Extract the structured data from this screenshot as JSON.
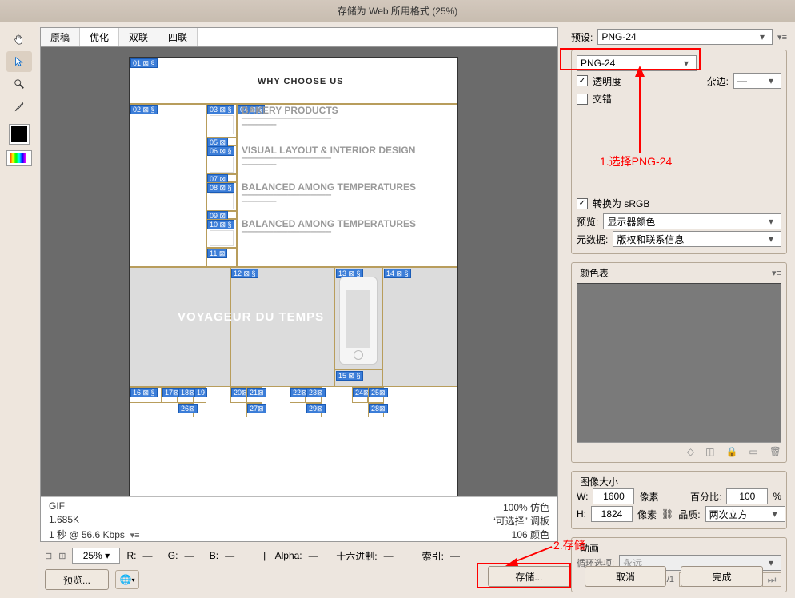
{
  "title": "存储为 Web 所用格式 (25%)",
  "tabs": {
    "t0": "原稿",
    "t1": "优化",
    "t2": "双联",
    "t3": "四联"
  },
  "tools": {
    "hand": "hand",
    "arrow": "arrow",
    "zoom": "zoom",
    "eyedrop": "eyedrop"
  },
  "preview": {
    "heading": "WHY CHOOSE US",
    "ghost": "VOYAGEUR DU TEMPS",
    "sub1": "BAKERY PRODUCTS",
    "sub2": "VISUAL LAYOUT & INTERIOR DESIGN",
    "sub3": "BALANCED AMONG TEMPERATURES",
    "sub4": "BALANCED AMONG TEMPERATURES"
  },
  "info": {
    "fmt": "GIF",
    "size": "1.685K",
    "time": "1 秒 @ 56.6 Kbps",
    "dither": "100% 仿色",
    "palette": "“可选择” 调板",
    "colors": "106 颜色"
  },
  "status": {
    "zoom": "25%",
    "r": "R:",
    "g": "G:",
    "b": "B:",
    "alpha": "Alpha:",
    "hex": "十六进制:",
    "index": "索引:",
    "dash": "—"
  },
  "right": {
    "presetLbl": "预设:",
    "preset": "PNG-24",
    "fmt": "PNG-24",
    "transparency": "透明度",
    "interlace": "交错",
    "matteLbl": "杂边:",
    "matte": "—",
    "srgb": "转换为 sRGB",
    "previewLbl": "预览:",
    "preview": "显示器颜色",
    "metaLbl": "元数据:",
    "meta": "版权和联系信息",
    "ctLbl": "颜色表",
    "sizeLbl": "图像大小",
    "w": "W:",
    "wval": "1600",
    "h": "H:",
    "hval": "1824",
    "px": "像素",
    "qualLbl": "品质:",
    "qual": "两次立方",
    "pctLbl": "百分比:",
    "pctval": "100",
    "pct": "%",
    "animLbl": "动画",
    "loopLbl": "循环选项:",
    "loop": "永远",
    "frames": "1/1"
  },
  "annotations": {
    "a1": "1.选择PNG-24",
    "a2": "2.存储"
  },
  "buttons": {
    "previewBtn": "预览...",
    "save": "存储...",
    "cancel": "取消",
    "done": "完成"
  }
}
